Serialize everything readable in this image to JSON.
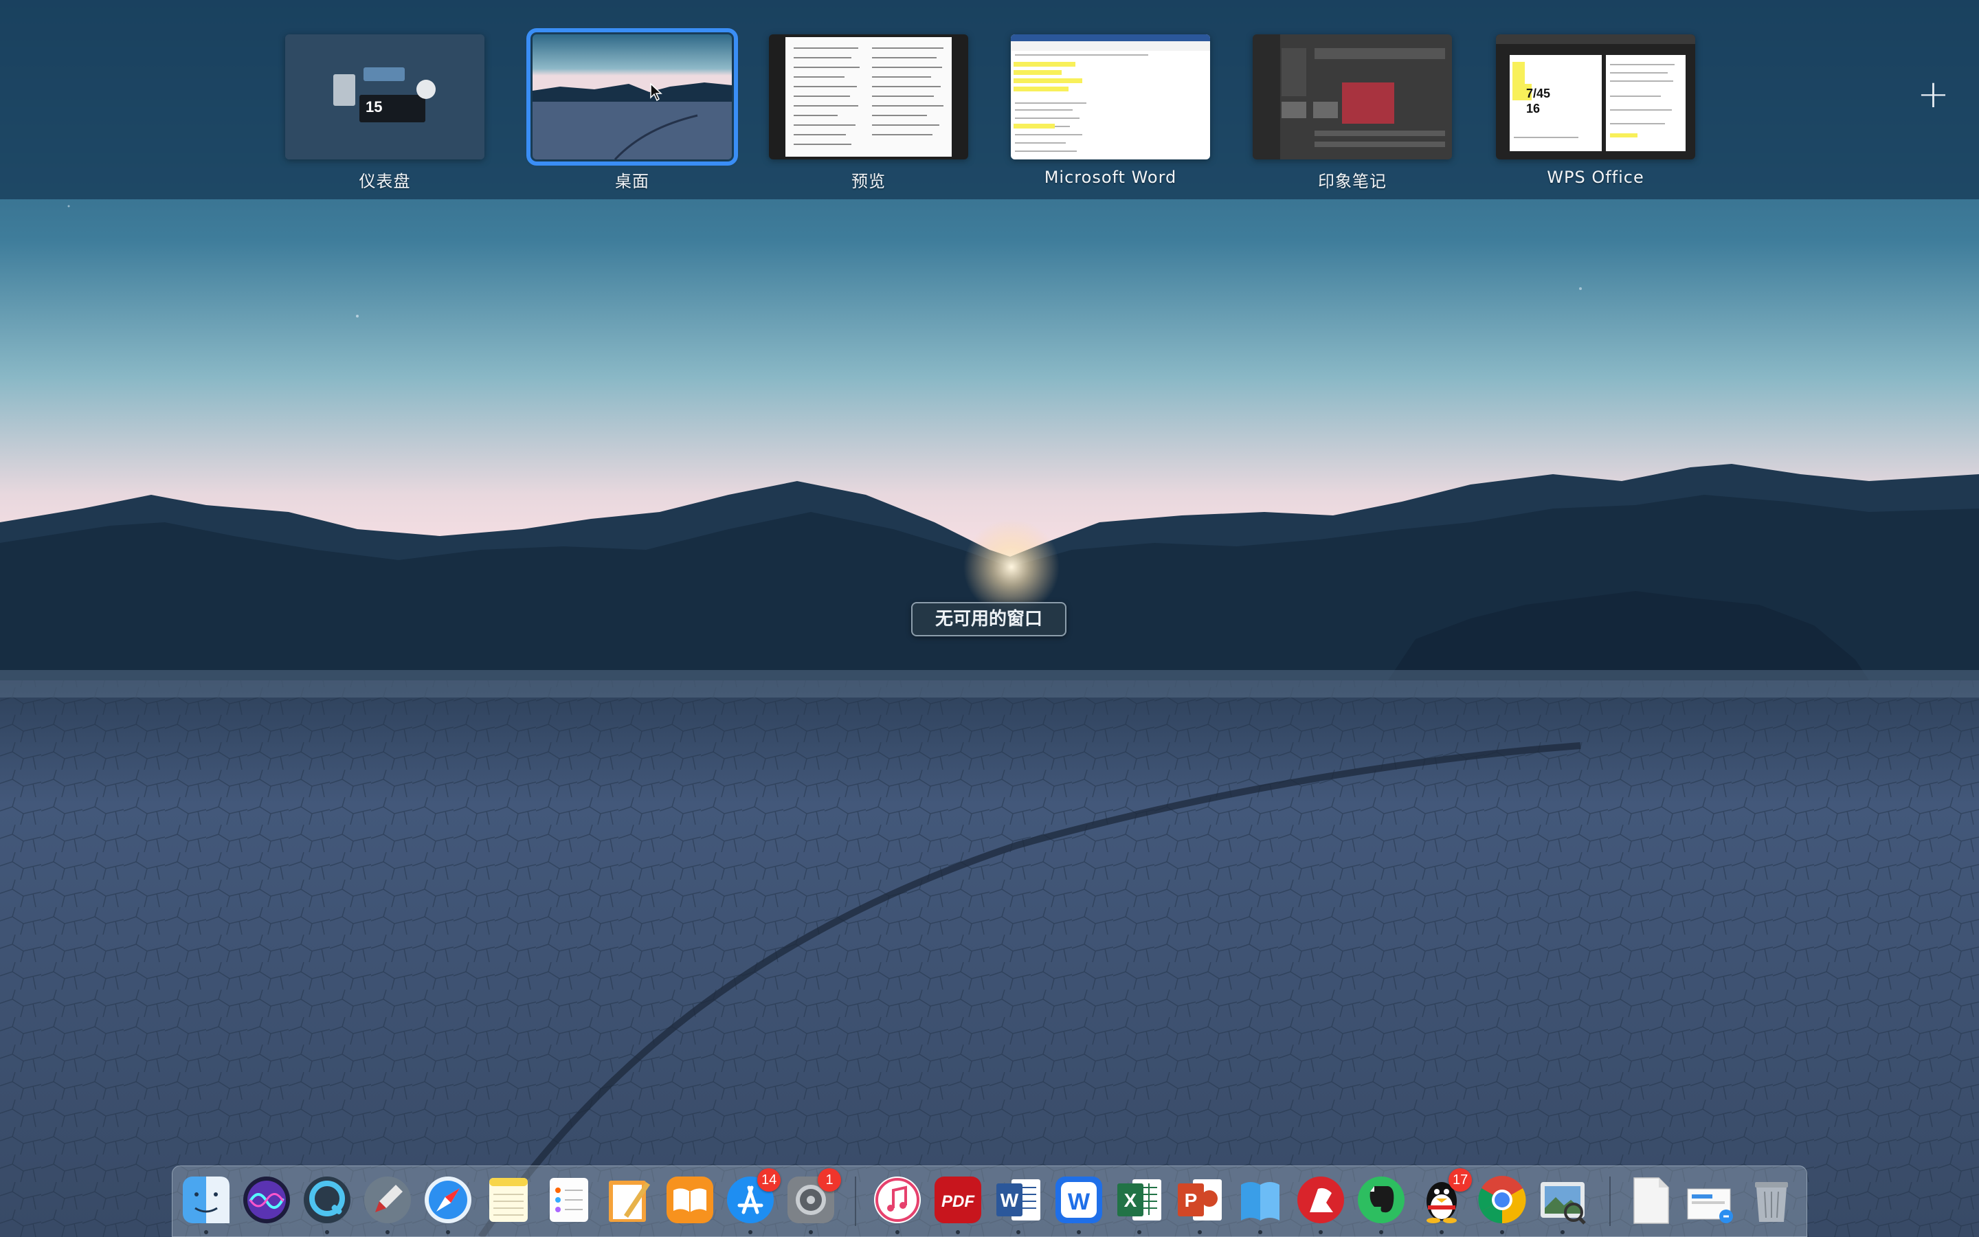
{
  "spaces": [
    {
      "label": "仪表盘",
      "thumb": "dashboard-widgets",
      "date_digit": "15",
      "selected": false
    },
    {
      "label": "桌面",
      "thumb": "desktop-wallpaper",
      "selected": true
    },
    {
      "label": "预览",
      "thumb": "preview-document",
      "selected": false
    },
    {
      "label": "Microsoft Word",
      "thumb": "word-document",
      "selected": false
    },
    {
      "label": "印象笔记",
      "thumb": "evernote-window",
      "selected": false
    },
    {
      "label": "WPS Office",
      "thumb": "wps-document",
      "thumb_text": [
        "7/45",
        "16"
      ],
      "selected": false
    }
  ],
  "add_space_label": "+",
  "no_windows_label": "无可用的窗口",
  "dock": {
    "apps": [
      {
        "name": "finder",
        "icon": "finder-icon",
        "running": true
      },
      {
        "name": "siri",
        "icon": "siri-icon",
        "running": false
      },
      {
        "name": "quicktime",
        "icon": "quicktime-icon",
        "running": true
      },
      {
        "name": "launchpad",
        "icon": "launchpad-icon",
        "running": true
      },
      {
        "name": "safari",
        "icon": "safari-icon",
        "running": true
      },
      {
        "name": "notes",
        "icon": "notes-icon",
        "running": false
      },
      {
        "name": "reminders",
        "icon": "reminders-icon",
        "running": false
      },
      {
        "name": "pages",
        "icon": "pages-icon",
        "running": false
      },
      {
        "name": "books",
        "icon": "books-icon",
        "running": false
      },
      {
        "name": "app-store",
        "icon": "app-store-icon",
        "badge": "14",
        "running": true
      },
      {
        "name": "system-preferences",
        "icon": "system-preferences-icon",
        "badge": "1",
        "running": true
      },
      {
        "name": "itunes",
        "icon": "itunes-icon",
        "running": true
      },
      {
        "name": "pdf-expert",
        "icon": "pdf-icon",
        "label": "PDF",
        "running": true
      },
      {
        "name": "microsoft-word",
        "icon": "word-icon",
        "label": "W",
        "running": true
      },
      {
        "name": "wps-office",
        "icon": "wps-icon",
        "label": "W",
        "running": true
      },
      {
        "name": "microsoft-excel",
        "icon": "excel-icon",
        "label": "X",
        "running": true
      },
      {
        "name": "microsoft-powerpoint",
        "icon": "powerpoint-icon",
        "label": "P",
        "running": true
      },
      {
        "name": "bookmarks-app",
        "icon": "bookmark-icon",
        "running": true
      },
      {
        "name": "youdao-dict",
        "icon": "youdao-icon",
        "running": true
      },
      {
        "name": "evernote",
        "icon": "evernote-icon",
        "running": true
      },
      {
        "name": "qq",
        "icon": "qq-icon",
        "badge": "17",
        "running": true
      },
      {
        "name": "chrome",
        "icon": "chrome-icon",
        "running": true
      },
      {
        "name": "preview",
        "icon": "preview-icon",
        "running": true
      },
      {
        "name": "document",
        "icon": "document-icon",
        "running": false
      },
      {
        "name": "screenshot-folder",
        "icon": "screenshot-icon",
        "running": false
      },
      {
        "name": "trash",
        "icon": "trash-icon",
        "running": false
      }
    ]
  },
  "colors": {
    "selection": "#3a8ef6",
    "badge": "#f0352c",
    "sky_top": "#2c5a7c",
    "sky_glow": "#f3d9df"
  }
}
